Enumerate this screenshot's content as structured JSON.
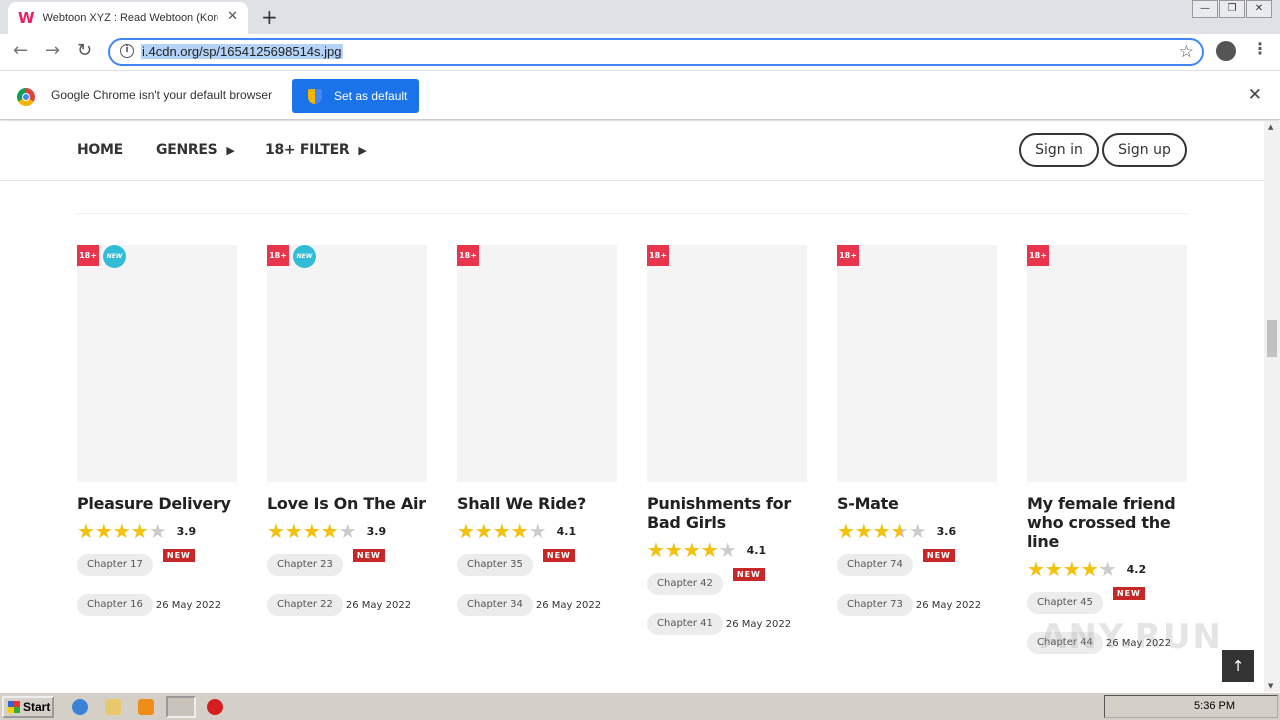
{
  "browser": {
    "tab_title": "Webtoon XYZ : Read Webtoon (Korean",
    "tab_favicon": "W",
    "url": "i.4cdn.org/sp/1654125698514s.jpg",
    "infobar_text": "Google Chrome isn't your default browser",
    "infobar_button": "Set as default"
  },
  "nav": {
    "home": "HOME",
    "genres": "GENRES",
    "filter": "18+ FILTER",
    "signin": "Sign in",
    "signup": "Sign up"
  },
  "cards": [
    {
      "title": "Pleasure Delivery",
      "badge": "18+",
      "new_badge": "NEW",
      "rating": 3.9,
      "rating_text": "3.9",
      "ch1": "Chapter 17",
      "ch1_tag": "NEW",
      "ch2": "Chapter 16",
      "ch2_date": "26 May 2022"
    },
    {
      "title": "Love Is On The Air",
      "badge": "18+",
      "new_badge": "NEW",
      "rating": 3.9,
      "rating_text": "3.9",
      "ch1": "Chapter 23",
      "ch1_tag": "NEW",
      "ch2": "Chapter 22",
      "ch2_date": "26 May 2022"
    },
    {
      "title": "Shall We Ride?",
      "badge": "18+",
      "new_badge": "",
      "rating": 4.1,
      "rating_text": "4.1",
      "ch1": "Chapter 35",
      "ch1_tag": "NEW",
      "ch2": "Chapter 34",
      "ch2_date": "26 May 2022"
    },
    {
      "title": "Punishments for Bad Girls",
      "badge": "18+",
      "new_badge": "",
      "rating": 4.1,
      "rating_text": "4.1",
      "ch1": "Chapter 42",
      "ch1_tag": "NEW",
      "ch2": "Chapter 41",
      "ch2_date": "26 May 2022"
    },
    {
      "title": "S-Mate",
      "badge": "18+",
      "new_badge": "",
      "rating": 3.6,
      "rating_text": "3.6",
      "ch1": "Chapter 74",
      "ch1_tag": "NEW",
      "ch2": "Chapter 73",
      "ch2_date": "26 May 2022"
    },
    {
      "title": "My female friend who crossed the line",
      "badge": "18+",
      "new_badge": "",
      "rating": 4.2,
      "rating_text": "4.2",
      "ch1": "Chapter 45",
      "ch1_tag": "NEW",
      "ch2": "Chapter 44",
      "ch2_date": "26 May 2022"
    }
  ],
  "watermark": "ANY.RUN",
  "taskbar": {
    "start": "Start",
    "clock": "5:36 PM"
  },
  "colors": {
    "badge18": "#e8354d",
    "new_circle": "#32bcd8",
    "new_tag": "#c62828",
    "star": "#f4c20d",
    "chrome_blue": "#1a73e8"
  }
}
